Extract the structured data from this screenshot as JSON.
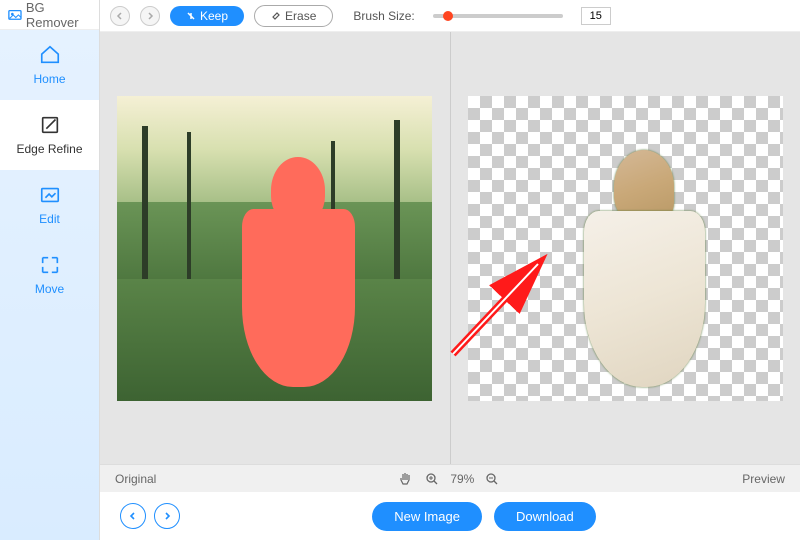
{
  "app": {
    "title": "BG Remover"
  },
  "sidebar": {
    "items": [
      {
        "label": "Home"
      },
      {
        "label": "Edge Refine"
      },
      {
        "label": "Edit"
      },
      {
        "label": "Move"
      }
    ]
  },
  "toolbar": {
    "keep_label": "Keep",
    "erase_label": "Erase",
    "brush_label": "Brush Size:",
    "brush_value": "15"
  },
  "status": {
    "left_label": "Original",
    "zoom_level": "79%",
    "right_label": "Preview"
  },
  "bottom": {
    "new_image_label": "New Image",
    "download_label": "Download"
  }
}
